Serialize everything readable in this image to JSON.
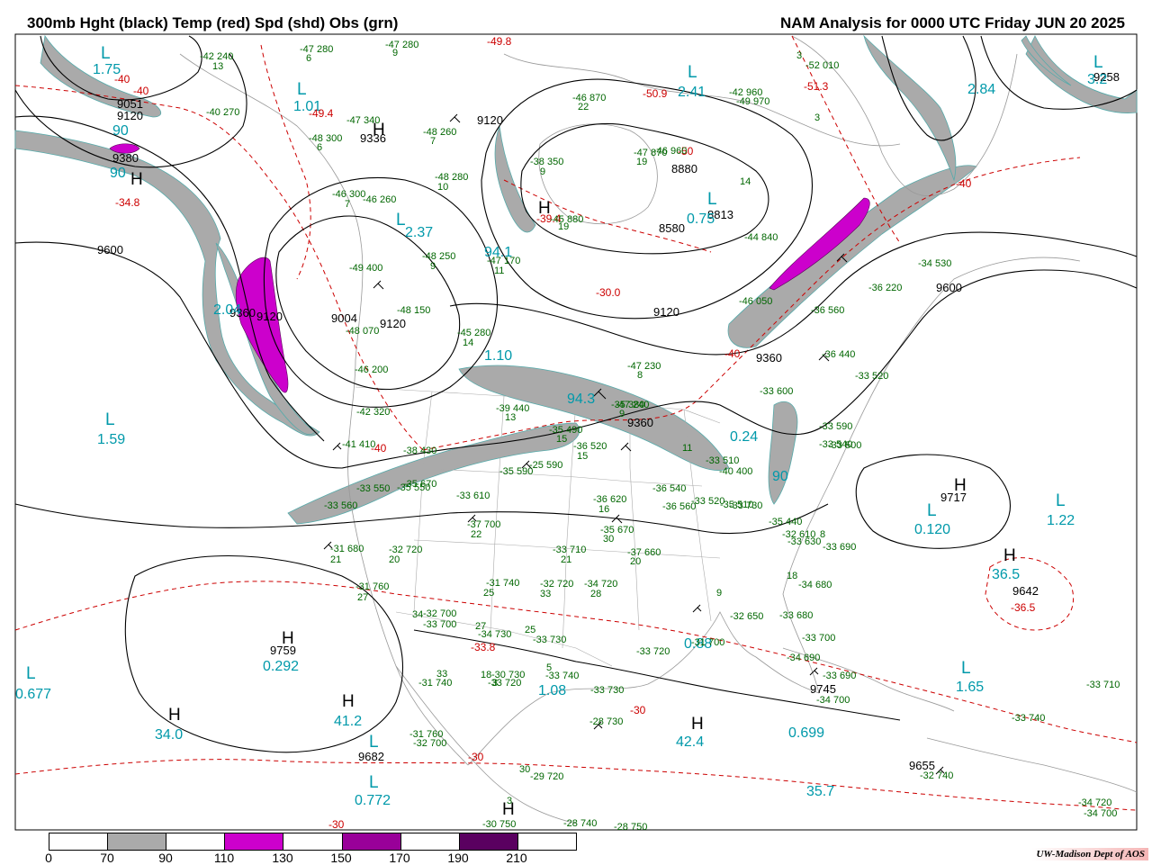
{
  "header": {
    "left_title": "300mb Hght (black) Temp (red) Spd (shd) Obs (grn)",
    "right_title": "NAM Analysis for 0000 UTC Friday  JUN 20 2025"
  },
  "legend": {
    "ticks": [
      "0",
      "70",
      "90",
      "110",
      "130",
      "150",
      "170",
      "190",
      "210"
    ],
    "colors": [
      "#ffffff",
      "#aaaaaa",
      "#ffffff",
      "#cc00cc",
      "#ffffff",
      "#990099",
      "#ffffff",
      "#5a0060"
    ]
  },
  "credit": "UW-Madison  Dept of AOS",
  "colors": {
    "height": "#000000",
    "temp": "#cc0000",
    "speed_label": "#0099aa",
    "obs": "#006600",
    "jet_gray": "#aaaaaa",
    "jet_magenta": "#cc00cc"
  },
  "height_labels": [
    "9051",
    "9120",
    "9380",
    "9336",
    "9120",
    "9600",
    "9360",
    "9120",
    "9004",
    "9120",
    "8880",
    "8813",
    "8580",
    "9120",
    "9360",
    "9360",
    "9600",
    "9258",
    "9717",
    "9642",
    "9759",
    "9682",
    "9655",
    "9745"
  ],
  "pressure_centers": [
    "L",
    "L",
    "L",
    "L",
    "L",
    "L",
    "H",
    "H",
    "H",
    "H",
    "H",
    "H",
    "H",
    "H",
    "L",
    "L",
    "L",
    "L",
    "L",
    "L",
    "L",
    "H",
    "H"
  ],
  "speed_labels": [
    "1.75",
    "90",
    "90",
    "1.01",
    "2.37",
    "94.1",
    "2.41",
    "0.75",
    "2.84",
    "3.2",
    "1.59",
    "1.10",
    "94.3",
    "0.24",
    "90",
    "0.120",
    "1.22",
    "36.5",
    "1.65",
    "0.292",
    "41.2",
    "34.0",
    "0.677",
    "1.08",
    "42.4",
    "0.699",
    "35.7",
    "0.772",
    "0.88",
    "2.04"
  ],
  "temp_labels": [
    "-40",
    "-40",
    "-49.4",
    "-49.8",
    "-34.8",
    "-39.4",
    "-50.9",
    "-51.3",
    "-50",
    "-30.0",
    "-40",
    "-40",
    "-40",
    "-36.5",
    "-33.8",
    "-30",
    "-30",
    "-30"
  ],
  "obs_labels": [
    "-42 240",
    "13",
    "-47 280",
    "6",
    "-47 280",
    "9",
    "-40 270",
    "-47 340",
    "-48 300",
    "6",
    "-48 260",
    "7",
    "-48 280",
    "10",
    "-46 300",
    "7",
    "-46 260",
    "-49 400",
    "-48 250",
    "9",
    "-47 170",
    "11",
    "-48 150",
    "-45 280",
    "14",
    "-48 070",
    "-46 200",
    "-42 320",
    "-41 410",
    "-38 430",
    "-33 550",
    "-35 550",
    "-33 560",
    "-35 670",
    "-33 610",
    "-35 590",
    "-25 590",
    "-37 700",
    "22",
    "-31 680",
    "21",
    "-32 720",
    "20",
    "-31 760",
    "27",
    "-33 710",
    "21",
    "-31 740",
    "25",
    "-32 720",
    "33",
    "-34 720",
    "28",
    "-37 660",
    "20",
    "-35 670",
    "30",
    "-36 620",
    "16",
    "-36 540",
    "-36 560",
    "-33 520",
    "-35 510",
    "-35 490",
    "15",
    "-36 520",
    "15",
    "-39 440",
    "13",
    "-47 230",
    "8",
    "-47 240",
    "9",
    "-38 350",
    "9",
    "-45 880",
    "19",
    "-46 870",
    "22",
    "-47 870",
    "19",
    "-46 960",
    "14",
    "-44 840",
    "-42 960",
    "-49 970",
    "3",
    "-52 010",
    "3",
    "-46 050",
    "-36 220",
    "-34 530",
    "-36 560",
    "-36 440",
    "-33 520",
    "-33 590",
    "-33 540",
    "-33 500",
    "-33 600",
    "-35 440",
    "-32 610",
    "-33 630",
    "8",
    "-33 690",
    "18",
    "-34 680",
    "9",
    "-33 680",
    "-33 700",
    "-34 690",
    "-33 690",
    "-34 700",
    "-33 710",
    "-33 740",
    "-34 720",
    "-34 700",
    "-30 730",
    "3",
    "-33 720",
    "-31 700",
    "-32 700",
    "-33 700",
    "25",
    "-33 730",
    "27",
    "-34 730",
    "34",
    "-31 760",
    "-32 700",
    "18",
    "-33 720",
    "5",
    "-33 740",
    "33",
    "-31 740",
    "30",
    "-29 720",
    "3",
    "-28 740",
    "-28 750",
    "-28 730",
    "-30 750",
    "-33 730",
    "-32 740",
    "-32 650",
    "-33 730",
    "-33 510",
    "-40 400",
    "11",
    "-35 380",
    "-35 350"
  ]
}
